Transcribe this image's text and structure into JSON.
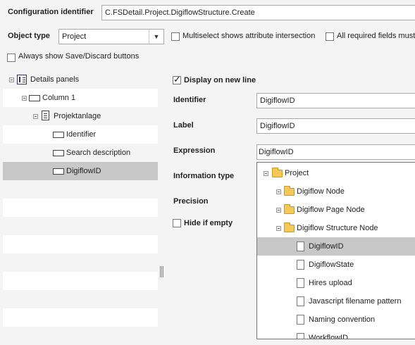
{
  "config": {
    "identifier_label": "Configuration identifier",
    "identifier_value": "C.FSDetail.Project.DigiflowStructure.Create"
  },
  "object_type": {
    "label": "Object type",
    "value": "Project"
  },
  "options": {
    "multiselect": "Multiselect shows attribute intersection",
    "required_fields": "All required fields must",
    "always_show": "Always show Save/Discard buttons"
  },
  "tree": {
    "root": "Details panels",
    "column": "Column 1",
    "group": "Projektanlage",
    "items": [
      "Identifier",
      "Search description",
      "DigiflowID"
    ]
  },
  "detail": {
    "display_new_line": "Display on new line",
    "identifier_label": "Identifier",
    "identifier_value": "DigiflowID",
    "label_label": "Label",
    "label_value": "DigiflowID",
    "expression_label": "Expression",
    "expression_value": "DigiflowID",
    "info_type_label": "Information type",
    "precision_label": "Precision",
    "hide_if_empty": "Hide if empty"
  },
  "expr_tree": {
    "root": "Project",
    "nodes": [
      "Digiflow Node",
      "Digiflow Page Node",
      "Digiflow Structure Node"
    ],
    "leaves": [
      "DigiflowID",
      "DigiflowState",
      "Hires upload",
      "Javascript filename pattern",
      "Naming convention",
      "WorkflowID"
    ]
  },
  "colors": {
    "selected": "#c8c8c8",
    "row_alt": "#ffffff",
    "row_base": "#f4f4f4"
  }
}
